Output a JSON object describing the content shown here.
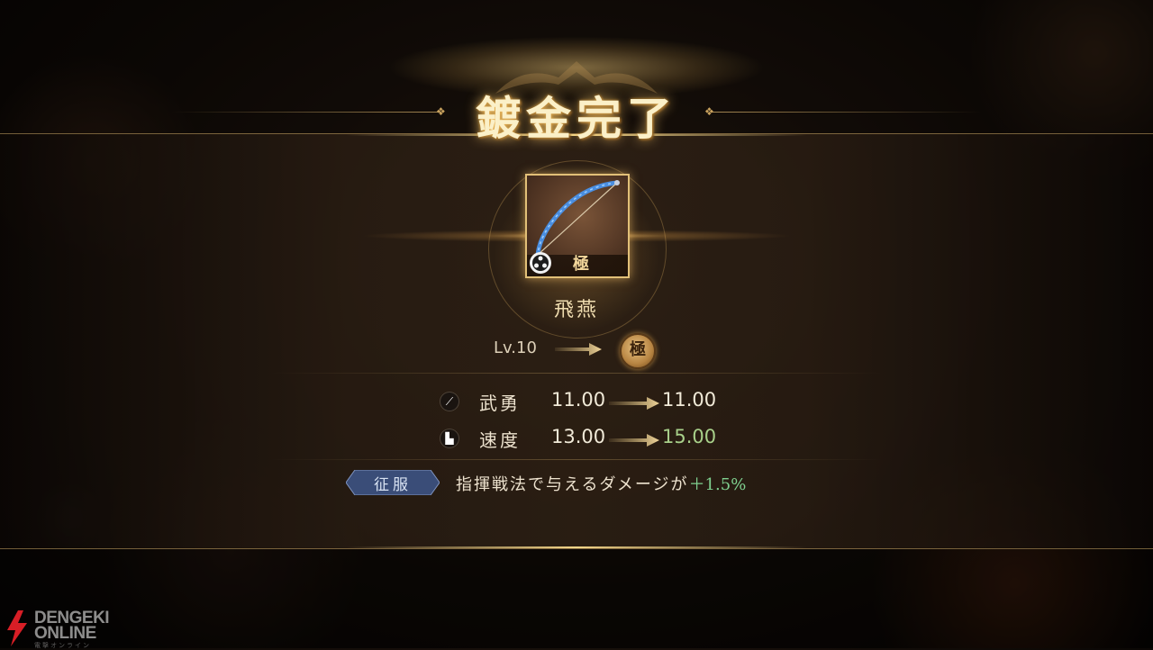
{
  "title": "鍍金完了",
  "item": {
    "grade_label": "極",
    "name": "飛燕"
  },
  "level": {
    "from": "Lv.10",
    "to_badge": "極"
  },
  "stats": [
    {
      "icon": "sword-icon",
      "label": "武勇",
      "from": "11.00",
      "to": "11.00",
      "increased": false
    },
    {
      "icon": "boot-icon",
      "label": "速度",
      "from": "13.00",
      "to": "15.00",
      "increased": true
    }
  ],
  "conquer": {
    "tag": "征服",
    "description": "指揮戦法で与えるダメージが",
    "value": "＋1.5%"
  },
  "watermark": {
    "line1": "DENGEKI",
    "line2": "ONLINE",
    "sub": "電撃オンライン"
  },
  "colors": {
    "gold": "#e2c078",
    "increase": "#a8d08a",
    "bonus": "#7fd08f",
    "tag_blue": "#3a4d78"
  }
}
